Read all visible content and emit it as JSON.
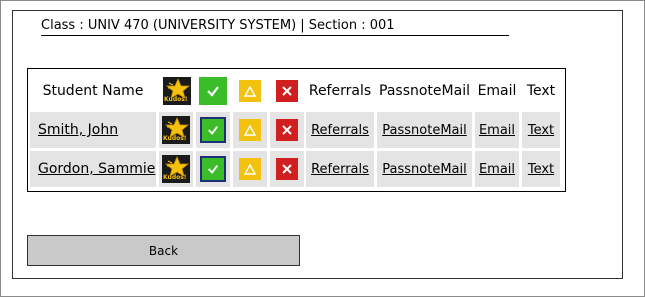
{
  "header": {
    "title": "Class : UNIV 470 (UNIVERSITY SYSTEM) | Section : 001"
  },
  "table": {
    "columns": {
      "student_name": "Student Name",
      "kudos": "Kudos!",
      "referrals": "Referrals",
      "passnotemail": "PassnoteMail",
      "email": "Email",
      "text": "Text"
    },
    "rows": [
      {
        "name": "Smith, John",
        "kudos": "Kudos!",
        "referrals": "Referrals",
        "passnotemail": "PassnoteMail",
        "email": "Email",
        "text": "Text"
      },
      {
        "name": "Gordon, Sammie",
        "kudos": "Kudos!",
        "referrals": "Referrals",
        "passnotemail": "PassnoteMail",
        "email": "Email",
        "text": "Text"
      }
    ]
  },
  "footer": {
    "back_label": "Back"
  },
  "colors": {
    "check": "#3bbd2a",
    "warning": "#f3c20f",
    "cancel": "#d11f1f",
    "selected_border": "#1e2f7a",
    "row_shade": "#e4e4e4"
  }
}
